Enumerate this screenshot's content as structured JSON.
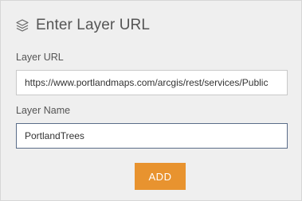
{
  "dialog": {
    "title": "Enter Layer URL",
    "title_icon": "layers-icon"
  },
  "layer_url": {
    "label": "Layer URL",
    "value": "https://www.portlandmaps.com/arcgis/rest/services/Public"
  },
  "layer_name": {
    "label": "Layer Name",
    "value": "PortlandTrees"
  },
  "add_button": {
    "label": "ADD"
  },
  "colors": {
    "accent": "#e8932f",
    "background": "#efefef",
    "focus_border": "#5a6c88"
  }
}
